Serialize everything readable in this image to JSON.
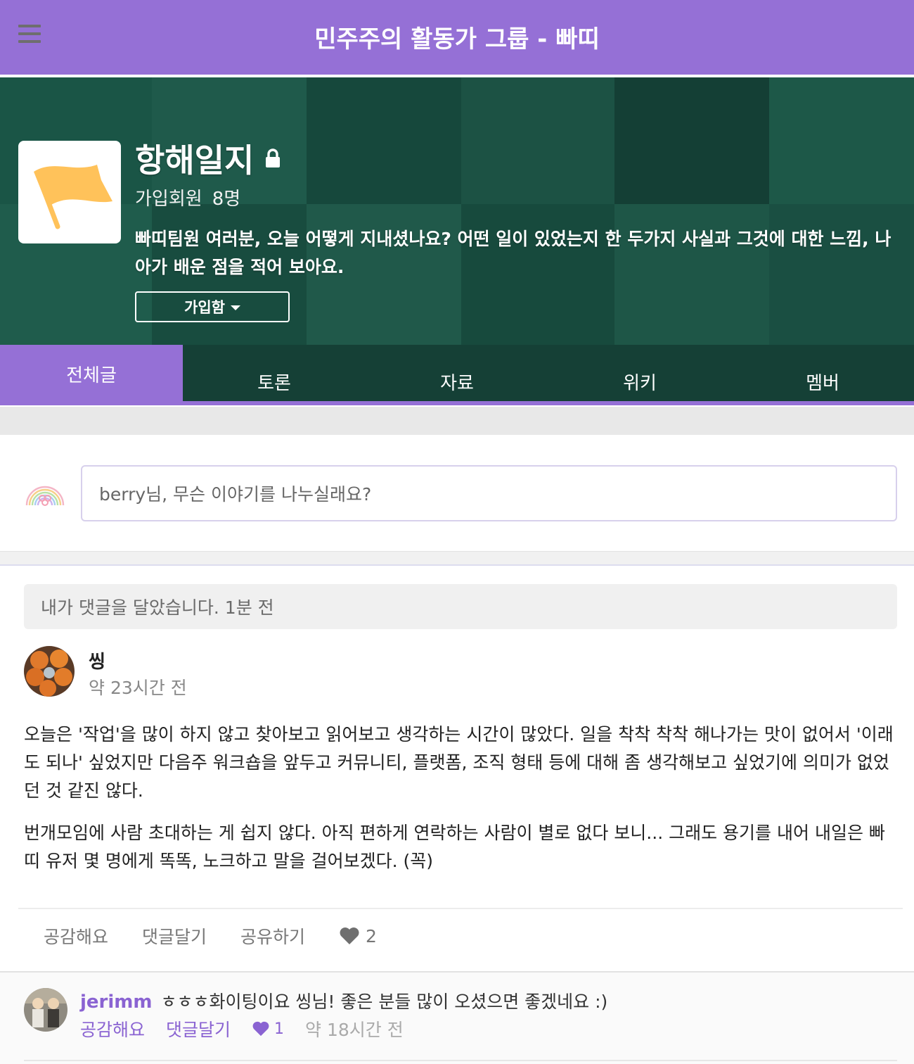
{
  "header": {
    "menu_icon": "hamburger-icon",
    "site_title": "민주주의 활동가 그룹 - 빠띠"
  },
  "group": {
    "title": "항해일지",
    "privacy_icon": "lock-icon",
    "member_label": "가입회원",
    "member_count": "8명",
    "description": "빠띠팀원 여러분, 오늘 어떻게 지내셨나요? 어떤 일이 있었는지 한 두가지 사실과 그것에 대한 느낌, 나아가 배운 점을 적어 보아요.",
    "join_button": "가입함",
    "colors": {
      "hero": "#184a3e",
      "accent": "#9570d6",
      "logo_flag": "#ffc25a"
    }
  },
  "tabs": [
    {
      "label": "전체글",
      "active": true
    },
    {
      "label": "토론",
      "active": false
    },
    {
      "label": "자료",
      "active": false
    },
    {
      "label": "위키",
      "active": false
    },
    {
      "label": "멤버",
      "active": false
    }
  ],
  "composer": {
    "placeholder": "berry님, 무슨 이야기를 나누실래요?"
  },
  "post": {
    "notice": "내가 댓글을 달았습니다. 1분 전",
    "author": "씽",
    "time": "약 23시간 전",
    "paragraphs": [
      "오늘은 '작업'을 많이 하지 않고 찾아보고 읽어보고 생각하는 시간이 많았다. 일을 착착 착착 해나가는 맛이 없어서 '이래도 되나' 싶었지만 다음주 워크숍을 앞두고 커뮤니티, 플랫폼, 조직 형태 등에 대해 좀 생각해보고 싶었기에 의미가 없었던 것 같진 않다.",
      "번개모임에 사람 초대하는 게 쉽지 않다. 아직 편하게 연락하는 사람이 별로 없다 보니... 그래도 용기를 내어 내일은 빠띠 유저 몇 명에게 똑똑, 노크하고 말을 걸어보겠다. (꼭)"
    ],
    "actions": {
      "like": "공감해요",
      "comment": "댓글달기",
      "share": "공유하기",
      "like_count": "2"
    }
  },
  "comment": {
    "author": "jerimm",
    "text": "ㅎㅎㅎ화이팅이요 씽님! 좋은 분들 많이 오셨으면 좋겠네요 :)",
    "like": "공감해요",
    "reply": "댓글달기",
    "like_count": "1",
    "time": "약 18시간 전"
  }
}
